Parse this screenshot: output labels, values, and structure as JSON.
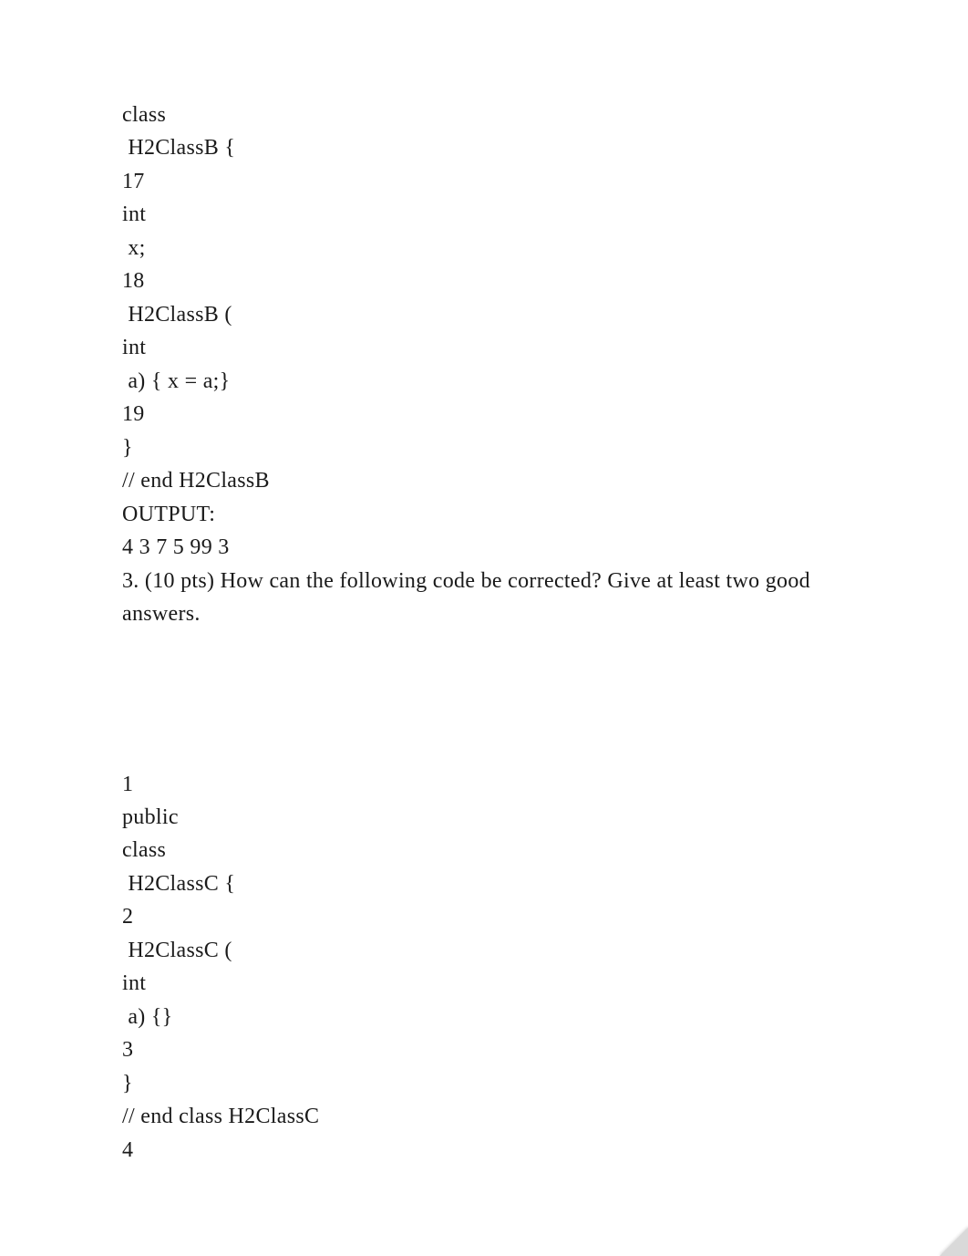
{
  "block1": [
    "class",
    " H2ClassB {",
    "17",
    "int",
    " x;",
    "18",
    " H2ClassB (",
    "int",
    " a) { x = a;}",
    "19",
    "}",
    "// end H2ClassB",
    "OUTPUT:",
    "4 3 7 5 99 3",
    "3. (10 pts) How can the following code be corrected? Give at least two good answers."
  ],
  "block2": [
    "1",
    "public",
    "class",
    " H2ClassC {",
    "2",
    " H2ClassC (",
    "int",
    " a) {}",
    "3",
    "}",
    "// end class H2ClassC",
    "4"
  ]
}
